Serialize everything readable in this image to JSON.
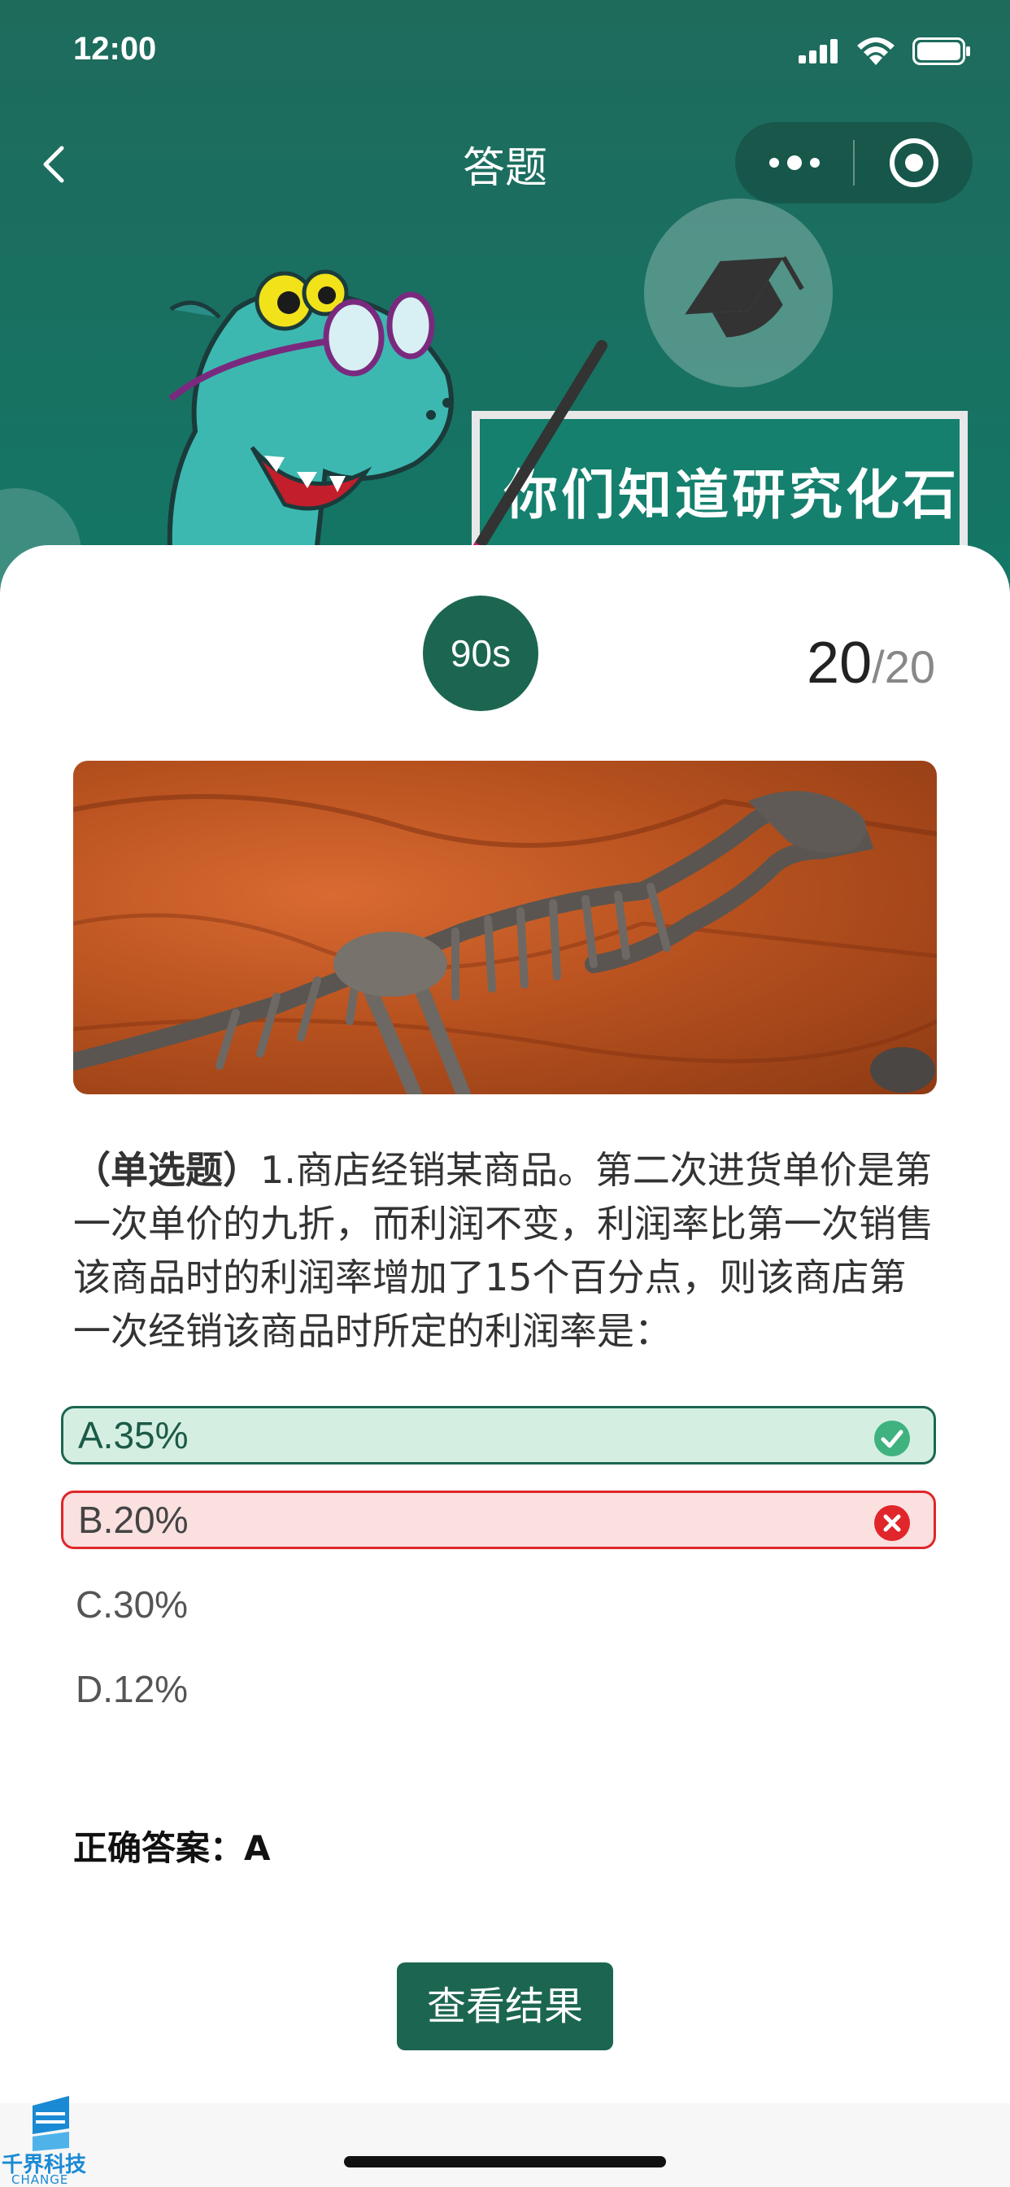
{
  "status": {
    "time": "12:00"
  },
  "nav": {
    "title": "答题"
  },
  "banner": {
    "board_text": "你们知道研究化石"
  },
  "quiz": {
    "timer": "90s",
    "current": "20",
    "separator": "/",
    "total": "20",
    "question_type": "（单选题）",
    "question_text": "1.商店经销某商品。第二次进货单价是第一次单价的九折，而利润不变，利润率比第一次销售该商品时的利润率增加了15个百分点，则该商店第一次经销该商品时所定的利润率是：",
    "options": [
      {
        "label": "A.35%",
        "state": "correct"
      },
      {
        "label": "B.20%",
        "state": "wrong"
      },
      {
        "label": "C.30%",
        "state": "none"
      },
      {
        "label": "D.12%",
        "state": "none"
      }
    ],
    "answer": "正确答案：A",
    "result_button": "查看结果"
  },
  "watermark": {
    "name": "千界科技",
    "sub": "CHANGE"
  },
  "colors": {
    "primary": "#1c6651",
    "correct_bg": "#d4efe2",
    "wrong_border": "#e0262a",
    "wrong_bg": "#fbe0e0"
  },
  "icons": [
    "signal-icon",
    "wifi-icon",
    "battery-icon",
    "back-icon",
    "more-icon",
    "close-target-icon",
    "graduation-cap-icon",
    "check-icon",
    "cross-icon"
  ]
}
